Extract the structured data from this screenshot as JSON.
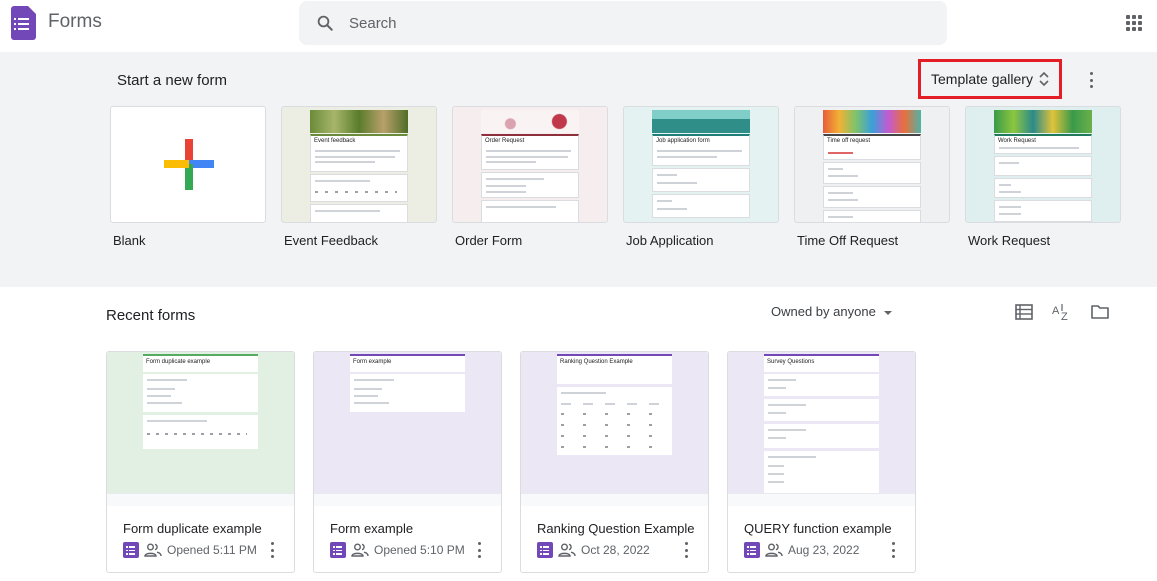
{
  "app": {
    "title": "Forms",
    "icon": "google-forms-logo"
  },
  "search": {
    "placeholder": "Search"
  },
  "templates": {
    "section_title": "Start a new form",
    "gallery_label": "Template gallery",
    "items": [
      {
        "label": "Blank"
      },
      {
        "label": "Event Feedback",
        "preview_title": "Event feedback"
      },
      {
        "label": "Order Form",
        "preview_title": "Order Request"
      },
      {
        "label": "Job Application",
        "preview_title": "Job application form"
      },
      {
        "label": "Time Off Request",
        "preview_title": "Time off request"
      },
      {
        "label": "Work Request",
        "preview_title": "Work Request"
      }
    ]
  },
  "recent": {
    "section_title": "Recent forms",
    "owner_filter": "Owned by anyone",
    "view_icons": [
      "list-view-icon",
      "sort-az-icon",
      "folder-icon"
    ],
    "forms": [
      {
        "title": "Form duplicate example",
        "meta": "Opened 5:11 PM",
        "preview_title": "Form duplicate example"
      },
      {
        "title": "Form example",
        "meta": "Opened 5:10 PM",
        "preview_title": "Form example"
      },
      {
        "title": "Ranking Question Example",
        "meta": "Oct 28, 2022",
        "preview_title": "Ranking Question Example"
      },
      {
        "title": "QUERY function example",
        "meta": "Aug 23, 2022",
        "preview_title": "Survey Questions"
      }
    ]
  },
  "colors": {
    "forms_purple": "#7248b9",
    "highlight_red": "#e41e26",
    "gray_bg": "#f1f3f4"
  }
}
